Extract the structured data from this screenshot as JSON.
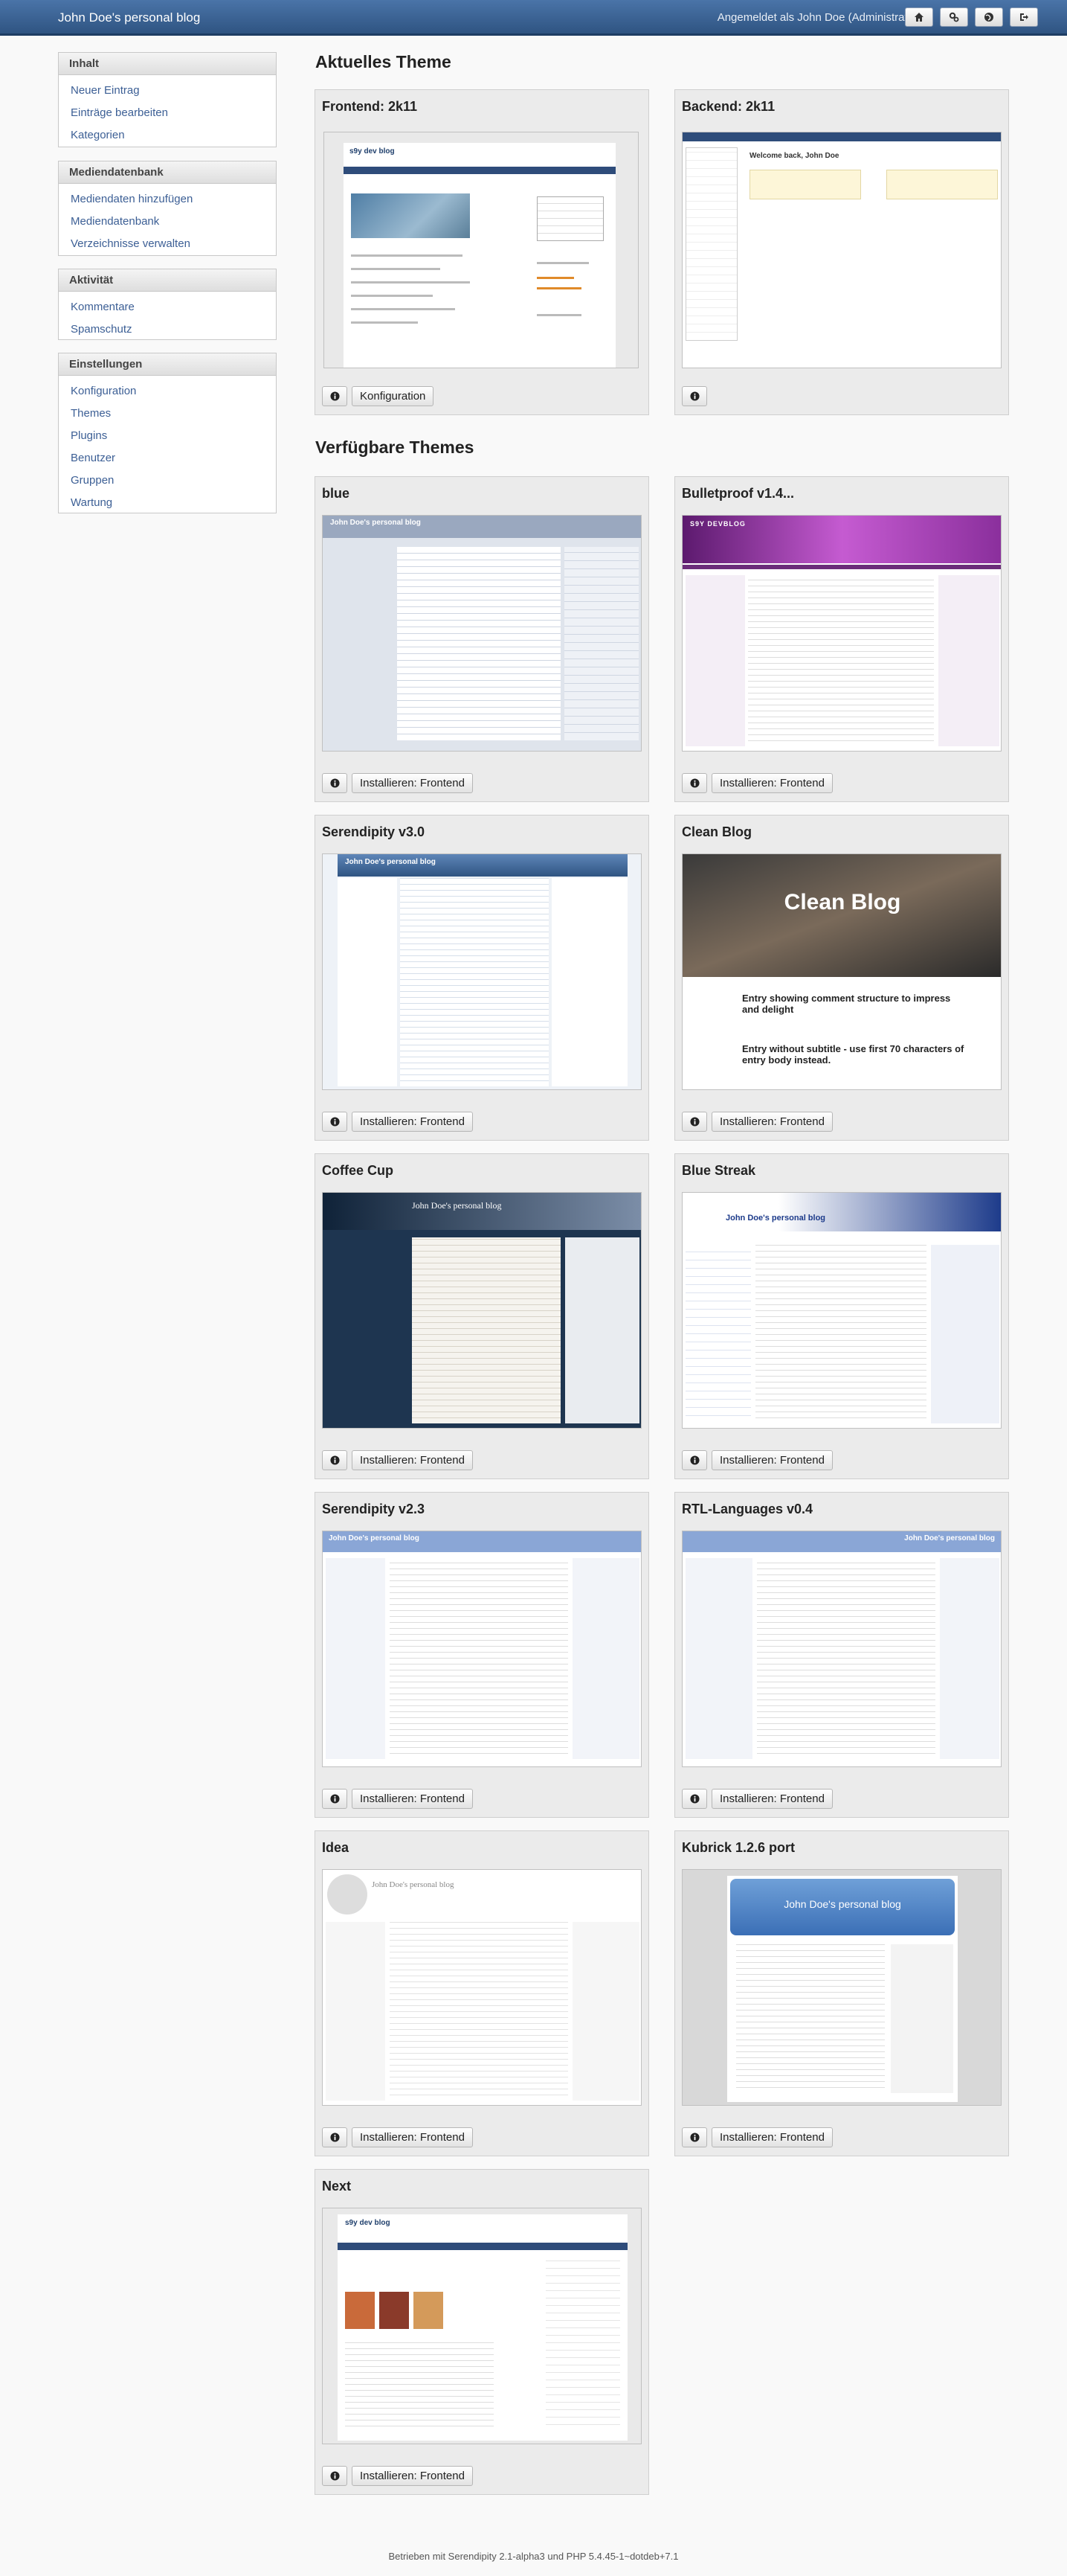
{
  "topbar": {
    "brand": "John Doe's personal blog",
    "user": "Angemeldet als John Doe (Administrator)",
    "icons": [
      "home-icon",
      "settings-icon",
      "globe-icon",
      "logout-icon"
    ]
  },
  "sidebar": [
    {
      "title": "Inhalt",
      "items": [
        "Neuer Eintrag",
        "Einträge bearbeiten",
        "Kategorien"
      ]
    },
    {
      "title": "Mediendatenbank",
      "items": [
        "Mediendaten hinzufügen",
        "Mediendatenbank",
        "Verzeichnisse verwalten"
      ]
    },
    {
      "title": "Aktivität",
      "items": [
        "Kommentare",
        "Spamschutz"
      ]
    },
    {
      "title": "Einstellungen",
      "items": [
        "Konfiguration",
        "Themes",
        "Plugins",
        "Benutzer",
        "Gruppen",
        "Wartung"
      ]
    }
  ],
  "current": {
    "heading": "Aktuelles Theme",
    "frontend": {
      "title": "Frontend: 2k11",
      "button": "Konfiguration"
    },
    "backend": {
      "title": "Backend: 2k11"
    }
  },
  "available": {
    "heading": "Verfügbare Themes",
    "install_label": "Installieren: Frontend",
    "themes": [
      {
        "title": "blue"
      },
      {
        "title": "Bulletproof v1.4..."
      },
      {
        "title": "Serendipity v3.0"
      },
      {
        "title": "Clean Blog"
      },
      {
        "title": "Coffee Cup"
      },
      {
        "title": "Blue Streak"
      },
      {
        "title": "Serendipity v2.3"
      },
      {
        "title": "RTL-Languages v0.4"
      },
      {
        "title": "Idea"
      },
      {
        "title": "Kubrick 1.2.6 port"
      },
      {
        "title": "Next"
      }
    ]
  },
  "thumbs": {
    "k11_blog": "s9y dev blog",
    "backend_welcome": "Welcome back, John Doe",
    "clean_blog_title": "Clean Blog",
    "clean_post1": "Entry showing comment structure to impress and delight",
    "clean_post2": "Entry without subtitle - use first 70 characters of entry body instead.",
    "blog_name": "John Doe's personal blog",
    "next_blog": "s9y dev blog",
    "bulletproof_name": "S9Y DEVBLOG"
  },
  "footer": "Betrieben mit Serendipity 2.1-alpha3 und PHP 5.4.45-1~dotdeb+7.1"
}
